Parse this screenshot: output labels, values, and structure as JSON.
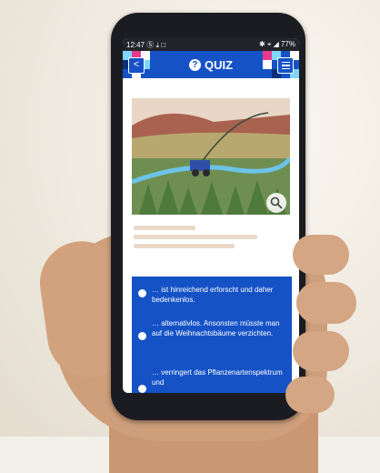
{
  "status_bar": {
    "time": "12:47",
    "left_icons": "Ⓢ ⤓ □",
    "right_icons": "✱ ⌖ ◢",
    "battery": "77%"
  },
  "app_bar": {
    "title": "QUIZ",
    "back_glyph": "<",
    "help_glyph": "?"
  },
  "quiz": {
    "answers": [
      {
        "text": "… ist hinreichend erforscht und daher bedenkenlos."
      },
      {
        "text": "… alternativlos. Ansonsten müsste man auf die Weihnachtsbäume verzichten."
      },
      {
        "text": "… verringert das Pflanzenartenspektrum und"
      }
    ]
  },
  "colors": {
    "brand_blue": "#1552c6",
    "phone_body": "#1b1c21",
    "status_bar": "#23242a",
    "skin": "#cf9f7b"
  },
  "icons": [
    "back-arrow-icon",
    "question-icon",
    "menu-icon",
    "zoom-icon",
    "radio-icon"
  ]
}
